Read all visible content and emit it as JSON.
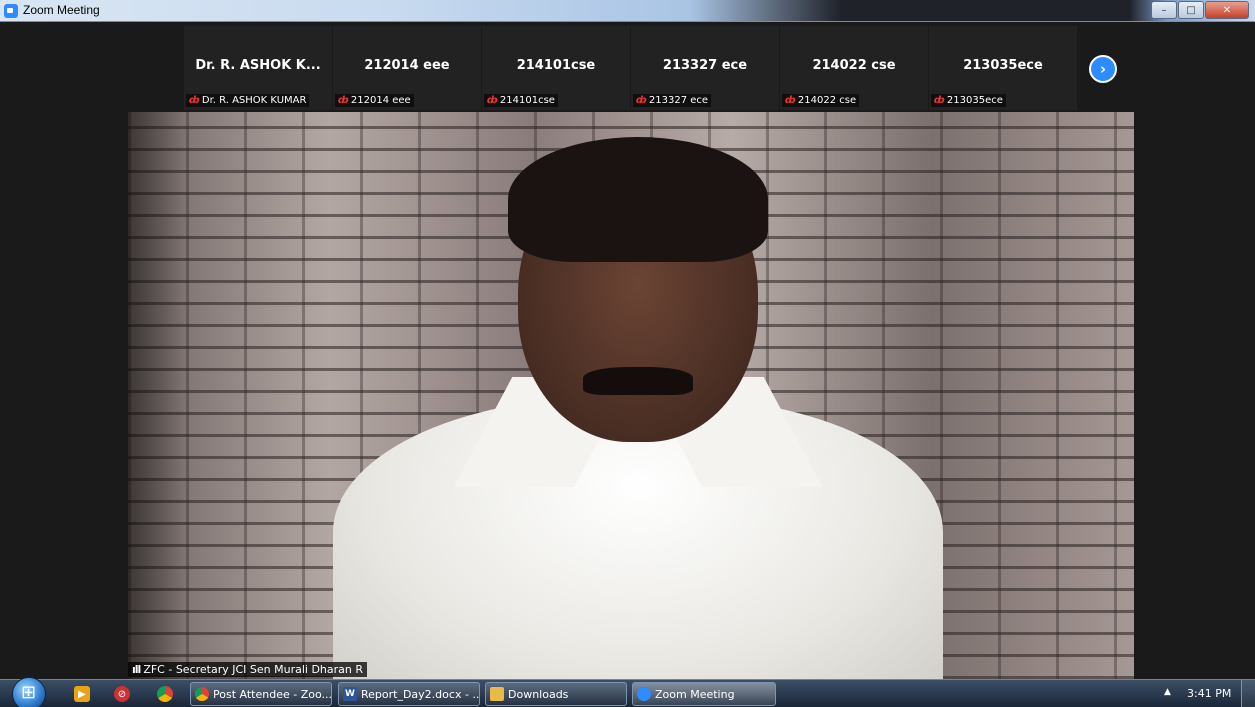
{
  "window": {
    "title": "Zoom Meeting",
    "controls": {
      "minimize": "–",
      "maximize": "□",
      "close": "✕"
    }
  },
  "gallery": {
    "participants": [
      {
        "name": "Dr. R. ASHOK K...",
        "label": "Dr. R. ASHOK KUMAR",
        "muted": true
      },
      {
        "name": "212014 eee",
        "label": "212014 eee",
        "muted": true
      },
      {
        "name": "214101cse",
        "label": "214101cse",
        "muted": true
      },
      {
        "name": "213327 ece",
        "label": "213327 ece",
        "muted": true
      },
      {
        "name": "214022 cse",
        "label": "214022 cse",
        "muted": true
      },
      {
        "name": "213035ece",
        "label": "213035ece",
        "muted": true
      }
    ],
    "next_icon": "chevron-right-icon",
    "next_symbol": "›"
  },
  "speaker": {
    "name": "ZFC - Secretary JCI Sen Murali Dharan R",
    "signal_symbol": "ıll"
  },
  "taskbar": {
    "tasks": [
      {
        "label": "Post Attendee - Zoo...",
        "icon": "chrome-icon"
      },
      {
        "label": "Report_Day2.docx - ...",
        "icon": "word-icon"
      },
      {
        "label": "Downloads",
        "icon": "folder-icon"
      },
      {
        "label": "Zoom Meeting",
        "icon": "zoom-icon"
      }
    ],
    "tray_arrow": "▲",
    "time": "3:41 PM"
  },
  "colors": {
    "accent": "#2d8cff",
    "muted_red": "#e33333"
  }
}
